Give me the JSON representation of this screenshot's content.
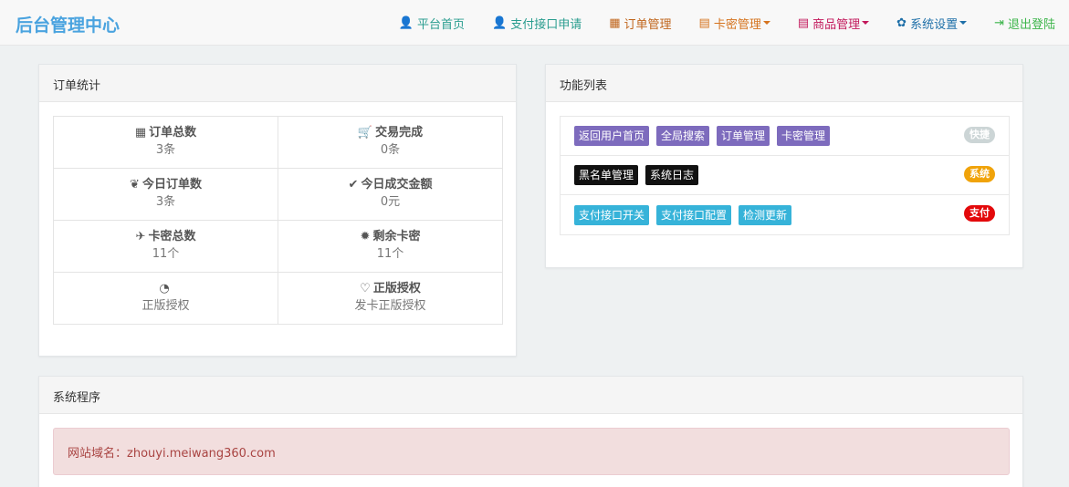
{
  "brand": "后台管理中心",
  "nav": [
    {
      "label": "平台首页",
      "icon": "user-icon",
      "glyph": "👤",
      "color": "teal",
      "caret": false
    },
    {
      "label": "支付接口申请",
      "icon": "user-icon",
      "glyph": "👤",
      "color": "teal",
      "caret": false
    },
    {
      "label": "订单管理",
      "icon": "calendar-icon",
      "glyph": "▦",
      "color": "brown",
      "caret": false
    },
    {
      "label": "卡密管理",
      "icon": "list-icon",
      "glyph": "▤",
      "color": "orange",
      "caret": true
    },
    {
      "label": "商品管理",
      "icon": "list-icon",
      "glyph": "▤",
      "color": "pink",
      "caret": true
    },
    {
      "label": "系统设置",
      "icon": "gear-icon",
      "glyph": "✿",
      "color": "blue",
      "caret": true
    },
    {
      "label": "退出登陆",
      "icon": "logout-icon",
      "glyph": "⇥",
      "color": "green",
      "caret": false
    }
  ],
  "stats_panel": {
    "title": "订单统计",
    "rows": [
      [
        {
          "label": "订单总数",
          "value": "3条",
          "icon": "grid-icon",
          "glyph": "▦"
        },
        {
          "label": "交易完成",
          "value": "0条",
          "icon": "cart-icon",
          "glyph": "🛒"
        }
      ],
      [
        {
          "label": "今日订单数",
          "value": "3条",
          "icon": "leaf-icon",
          "glyph": "❦"
        },
        {
          "label": "今日成交金额",
          "value": "0元",
          "icon": "check-icon",
          "glyph": "✔"
        }
      ],
      [
        {
          "label": "卡密总数",
          "value": "11个",
          "icon": "plane-icon",
          "glyph": "✈"
        },
        {
          "label": "剩余卡密",
          "value": "11个",
          "icon": "sun-icon",
          "glyph": "✹"
        }
      ],
      [
        {
          "label": "",
          "value": "正版授权",
          "icon": "dashboard-icon",
          "glyph": "◔"
        },
        {
          "label": "正版授权",
          "value": "发卡正版授权",
          "icon": "heart-icon",
          "glyph": "♡"
        }
      ]
    ]
  },
  "func_panel": {
    "title": "功能列表",
    "rows": [
      {
        "tags": [
          "返回用户首页",
          "全局搜索",
          "订单管理",
          "卡密管理"
        ],
        "tag_color": "purple",
        "badge": "快捷",
        "badge_color": "gray"
      },
      {
        "tags": [
          "黑名单管理",
          "系统日志"
        ],
        "tag_color": "black",
        "badge": "系统",
        "badge_color": "gold"
      },
      {
        "tags": [
          "支付接口开关",
          "支付接口配置",
          "检测更新"
        ],
        "tag_color": "cyan",
        "badge": "支付",
        "badge_color": "red"
      }
    ]
  },
  "system_panel": {
    "title": "系统程序",
    "domain_label": "网站域名：",
    "domain_value": "zhouyi.meiwang360.com"
  }
}
